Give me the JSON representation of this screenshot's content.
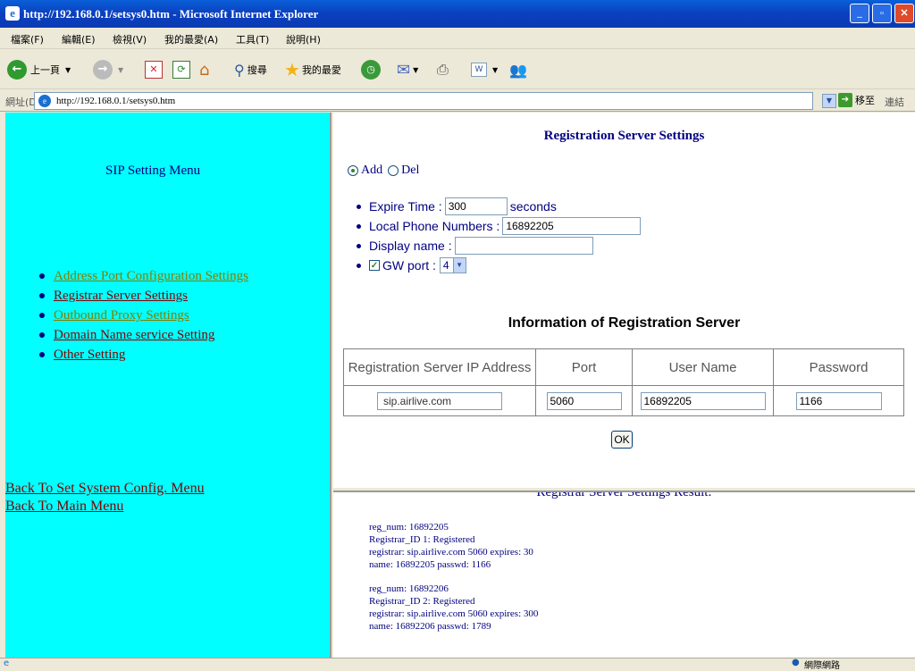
{
  "window": {
    "title": "http://192.168.0.1/setsys0.htm - Microsoft Internet Explorer"
  },
  "menubar": [
    "檔案(F)",
    "編輯(E)",
    "檢視(V)",
    "我的最愛(A)",
    "工具(T)",
    "說明(H)"
  ],
  "toolbar": {
    "back": "上一頁",
    "search": "搜尋",
    "favorites": "我的最愛"
  },
  "address": {
    "label": "網址(D)",
    "url": "http://192.168.0.1/setsys0.htm",
    "go": "移至",
    "links": "連結"
  },
  "left": {
    "title": "SIP Setting Menu",
    "items": [
      {
        "label": "Address Port Configuration Settings",
        "style": "olive"
      },
      {
        "label": "Registrar Server Settings",
        "style": "maroon"
      },
      {
        "label": "Outbound Proxy Settings",
        "style": "olive"
      },
      {
        "label": "Domain Name service Setting",
        "style": "maroon"
      },
      {
        "label": "Other Setting",
        "style": "maroon"
      }
    ],
    "back_config": "Back To Set System Config. Menu",
    "back_main": "Back To Main Menu"
  },
  "form": {
    "title": "Registration Server Settings",
    "radio_add": "Add",
    "radio_del": "Del",
    "expire_label": "Expire Time :",
    "expire_value": "300",
    "expire_unit": "seconds",
    "local_label": "Local Phone Numbers :",
    "local_value": "16892205",
    "display_label": "Display name :",
    "display_value": "",
    "gw_label": "GW port :",
    "gw_value": "4"
  },
  "info": {
    "title": "Information of Registration Server",
    "headers": [
      "Registration Server IP Address",
      "Port",
      "User Name",
      "Password"
    ],
    "row": [
      "sip.airlive.com",
      "5060",
      "16892205",
      "1166"
    ],
    "ok": "OK"
  },
  "result": {
    "title": "Registrar Server Settings Result:",
    "lines": [
      "reg_num: 16892205",
      "Registrar_ID 1: Registered",
      "registrar: sip.airlive.com 5060 expires: 30",
      "name: 16892205 passwd: 1166",
      "",
      "reg_num: 16892206",
      "Registrar_ID 2: Registered",
      "registrar: sip.airlive.com 5060 expires: 300",
      "name: 16892206 passwd: 1789"
    ]
  },
  "status": {
    "zone": "網際網路"
  }
}
